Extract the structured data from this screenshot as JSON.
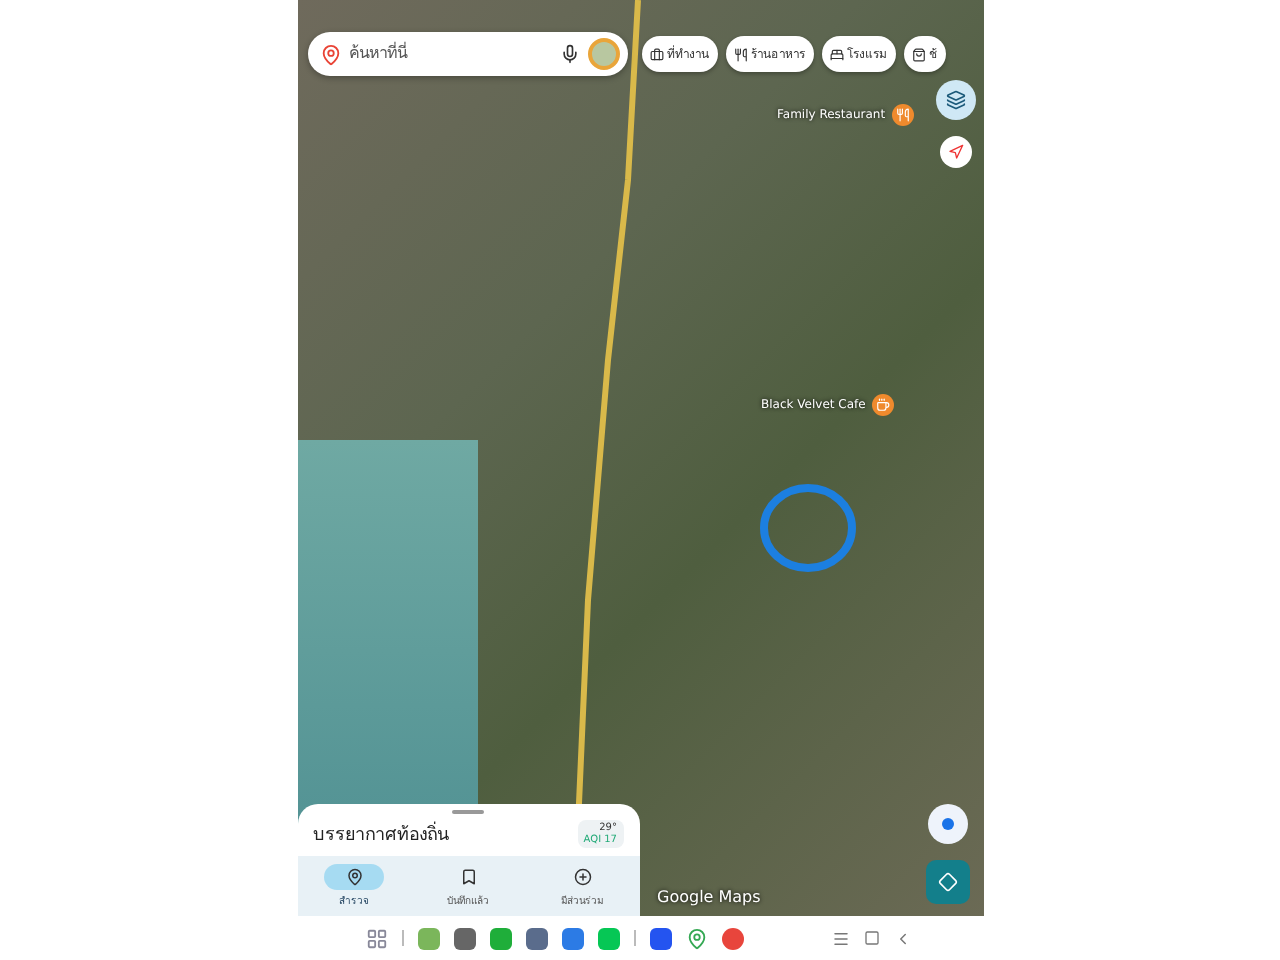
{
  "search": {
    "placeholder": "ค้นหาที่นี่"
  },
  "chips": [
    {
      "label": "ที่ทำงาน",
      "kind": "work"
    },
    {
      "label": "ร้านอาหาร",
      "kind": "food"
    },
    {
      "label": "โรงแรม",
      "kind": "hotel"
    },
    {
      "label": "ช้",
      "kind": "shop"
    }
  ],
  "map": {
    "places": [
      {
        "label": "Family Restaurant",
        "kind": "food"
      },
      {
        "label": "Black Velvet Cafe",
        "kind": "cafe"
      }
    ],
    "attribution": "Google Maps"
  },
  "sheet": {
    "title": "บรรยากาศท้องถิ่น",
    "temperature": "29°",
    "aqi": "AQI 17"
  },
  "nav": [
    {
      "label": "สำรวจ",
      "kind": "explore",
      "selected": true
    },
    {
      "label": "บันทึกแล้ว",
      "kind": "saved",
      "selected": false
    },
    {
      "label": "มีส่วนร่วม",
      "kind": "contribute",
      "selected": false
    }
  ]
}
